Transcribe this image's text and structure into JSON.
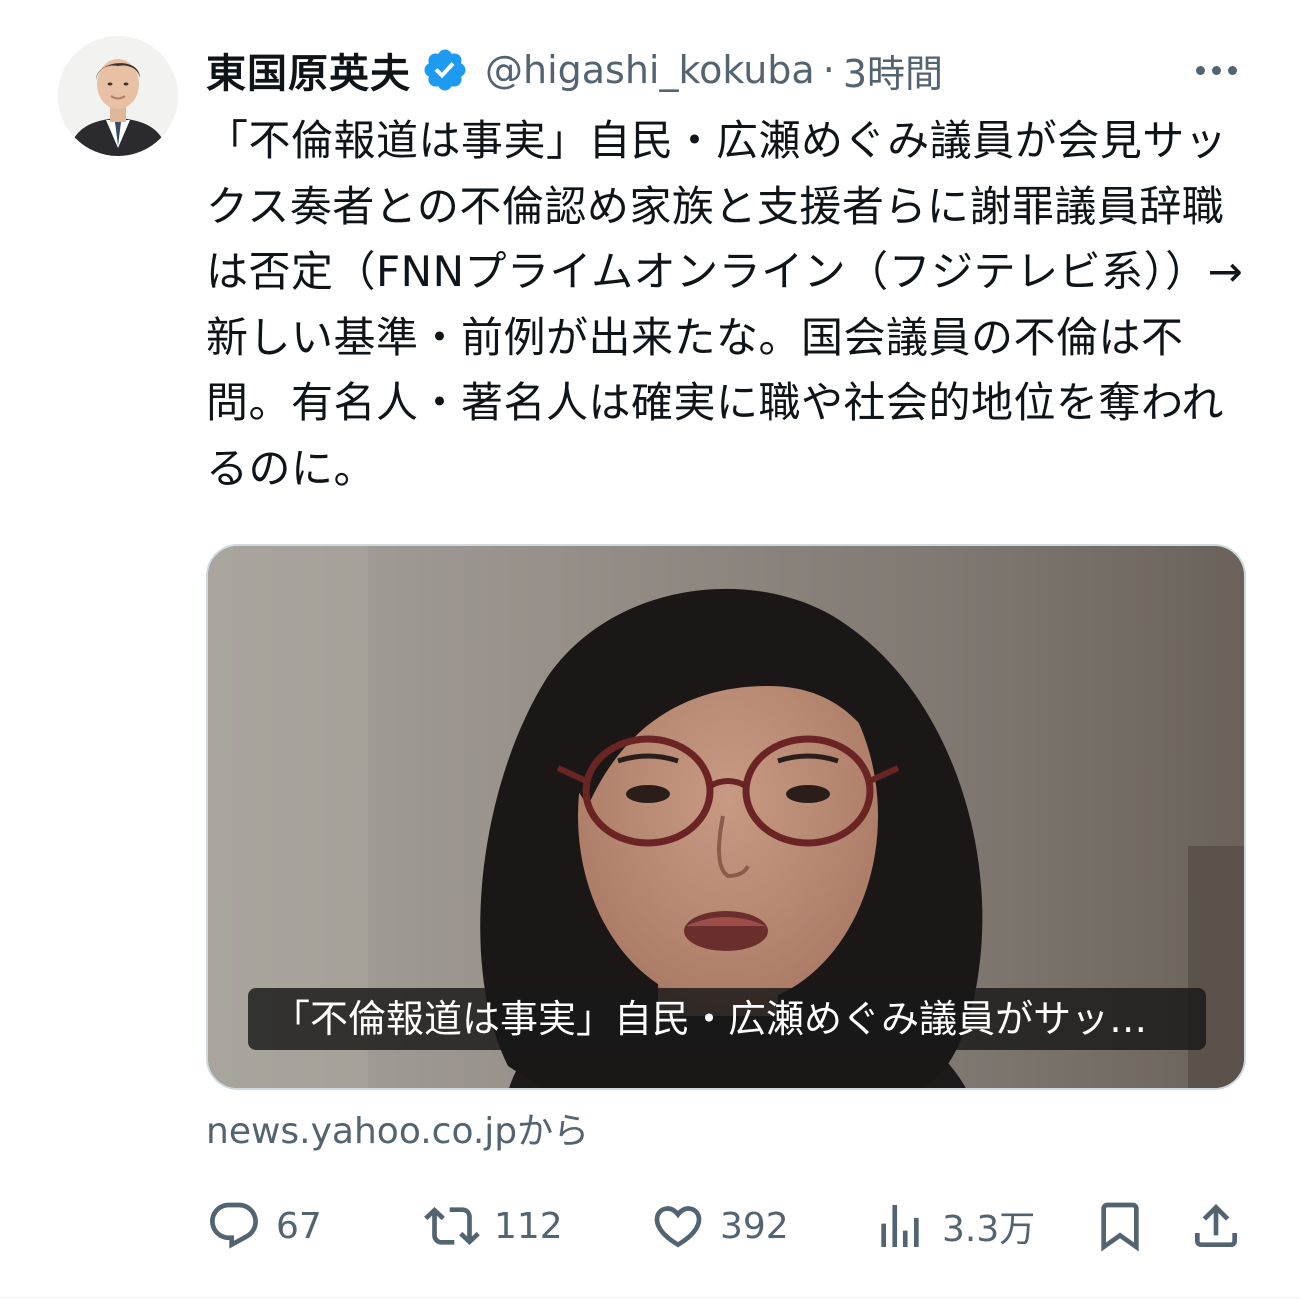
{
  "author": {
    "display_name": "東国原英夫",
    "handle": "@higashi_kokuba",
    "separator": "·",
    "timestamp": "3時間",
    "avatar_icon": "person-avatar",
    "verified_icon": "verified-badge-icon",
    "verified_color": "#1d9bf0"
  },
  "tweet": {
    "text": "「不倫報道は事実」自民・広瀬めぐみ議員が会見サックス奏者との不倫認め家族と支援者らに謝罪議員辞職は否定（FNNプライムオンライン（フジテレビ系））→新しい基準・前例が出来たな。国会議員の不倫は不問。有名人・著名人は確実に職や社会的地位を奪われるのに。"
  },
  "media": {
    "caption": "「不倫報道は事実」自民・広瀬めぐみ議員がサッ…",
    "image_subject": "woman-wearing-glasses-portrait"
  },
  "link_source": "news.yahoo.co.jpから",
  "actions": {
    "reply": {
      "icon": "reply-icon",
      "count": "67"
    },
    "retweet": {
      "icon": "retweet-icon",
      "count": "112"
    },
    "like": {
      "icon": "heart-icon",
      "count": "392"
    },
    "views": {
      "icon": "views-chart-icon",
      "count": "3.3万"
    },
    "bookmark": {
      "icon": "bookmark-icon"
    },
    "share": {
      "icon": "share-icon"
    }
  },
  "colors": {
    "text_primary": "#0f1419",
    "text_secondary": "#536471",
    "accent": "#1d9bf0"
  }
}
